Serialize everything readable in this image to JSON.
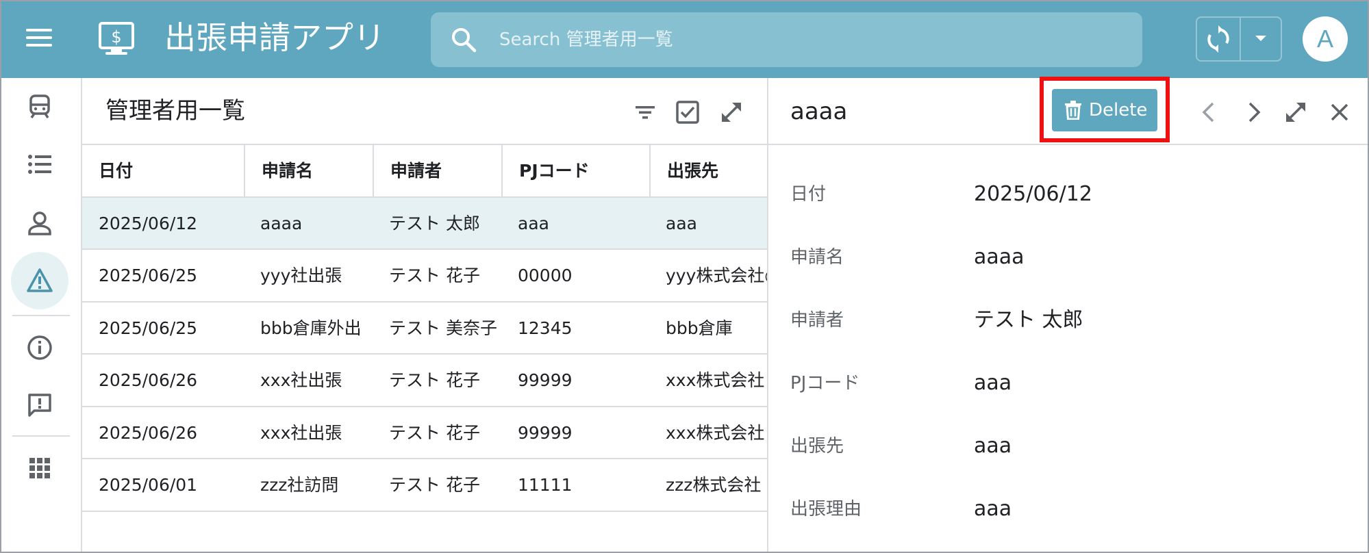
{
  "app": {
    "title": "出張申請アプリ",
    "search_placeholder": "Search 管理者用一覧",
    "avatar_letter": "A",
    "colors": {
      "primary": "#5ea7bf",
      "selected_row": "#e6f1f4",
      "highlight": "#ee1111"
    }
  },
  "rail": {
    "items": [
      {
        "icon": "train-icon",
        "active": false
      },
      {
        "icon": "list-icon",
        "active": false
      },
      {
        "icon": "person-icon",
        "active": false
      },
      {
        "icon": "warning-icon",
        "active": true
      },
      {
        "icon": "info-icon",
        "active": false
      },
      {
        "icon": "feedback-icon",
        "active": false
      },
      {
        "icon": "apps-grid-icon",
        "active": false
      }
    ]
  },
  "list": {
    "title": "管理者用一覧",
    "columns": [
      "日付",
      "申請名",
      "申請者",
      "PJコード",
      "出張先"
    ],
    "rows": [
      {
        "date": "2025/06/12",
        "name": "aaaa",
        "applicant": "テスト 太郎",
        "pj": "aaa",
        "dest": "aaa",
        "selected": true
      },
      {
        "date": "2025/06/25",
        "name": "yyy社出張",
        "applicant": "テスト 花子",
        "pj": "00000",
        "dest": "yyy株式会社○",
        "selected": false
      },
      {
        "date": "2025/06/25",
        "name": "bbb倉庫外出",
        "applicant": "テスト 美奈子",
        "pj": "12345",
        "dest": "bbb倉庫",
        "selected": false
      },
      {
        "date": "2025/06/26",
        "name": "xxx社出張",
        "applicant": "テスト 花子",
        "pj": "99999",
        "dest": "xxx株式会社",
        "selected": false
      },
      {
        "date": "2025/06/26",
        "name": "xxx社出張",
        "applicant": "テスト 花子",
        "pj": "99999",
        "dest": "xxx株式会社",
        "selected": false
      },
      {
        "date": "2025/06/01",
        "name": "zzz社訪問",
        "applicant": "テスト 花子",
        "pj": "11111",
        "dest": "zzz株式会社",
        "selected": false
      }
    ]
  },
  "detail": {
    "title": "aaaa",
    "delete_label": "Delete",
    "fields": [
      {
        "label": "日付",
        "value": "2025/06/12"
      },
      {
        "label": "申請名",
        "value": "aaaa"
      },
      {
        "label": "申請者",
        "value": "テスト 太郎"
      },
      {
        "label": "PJコード",
        "value": "aaa"
      },
      {
        "label": "出張先",
        "value": "aaa"
      },
      {
        "label": "出張理由",
        "value": "aaa"
      }
    ]
  }
}
